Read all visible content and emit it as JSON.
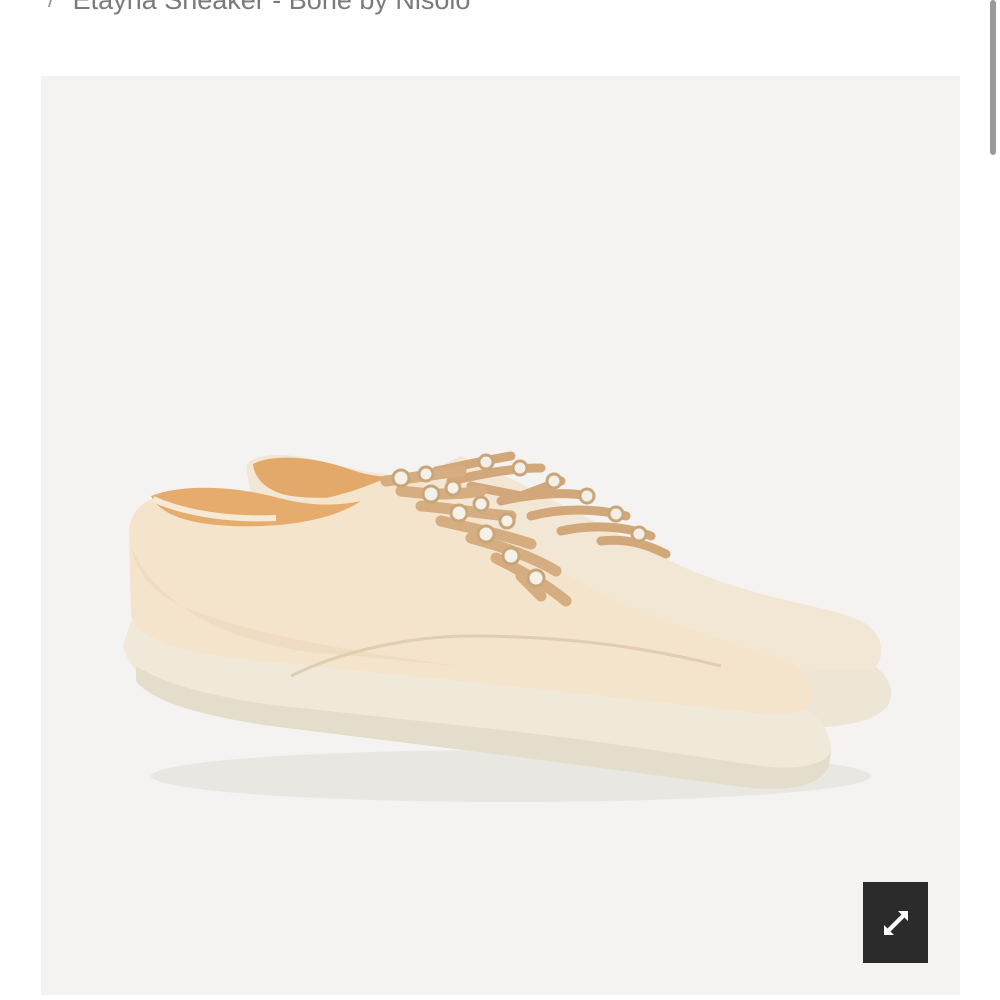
{
  "breadcrumb": {
    "separator": "/",
    "current": "Etayna Sneaker - Bone by Nisolo"
  },
  "product": {
    "image_alt": "Etayna Sneaker - Bone by Nisolo",
    "colors": {
      "background": "#f4f3f1",
      "upper": "#f3e4cf",
      "sole": "#f0eadb",
      "lining": "#e7b178",
      "laces": "#d5ad80"
    }
  },
  "zoom_button": {
    "icon": "expand-icon"
  }
}
